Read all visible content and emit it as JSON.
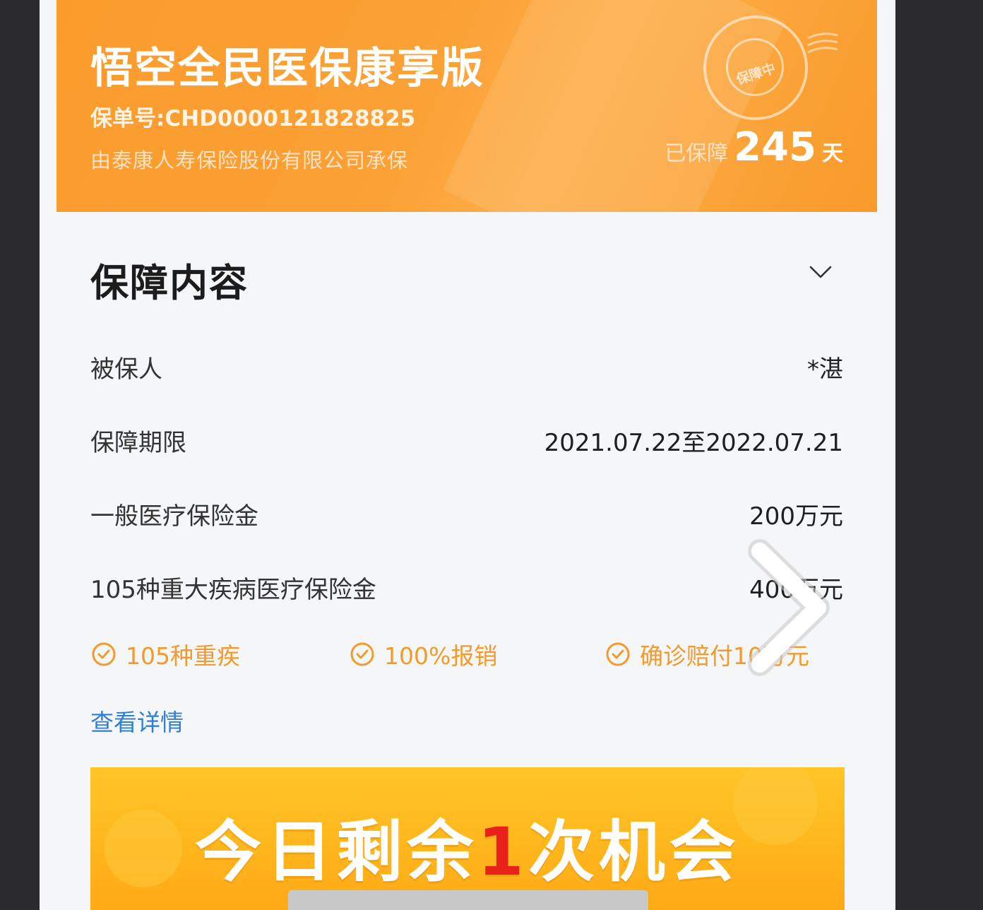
{
  "policy": {
    "title": "悟空全民医保康享版",
    "number_label": "保单号:CHD0000121828825",
    "underwriter": "由泰康人寿保险股份有限公司承保",
    "stamp_text": "保障中",
    "guarded_label": "已保障",
    "guarded_days": "245",
    "guarded_unit": "天"
  },
  "coverage": {
    "section_title": "保障内容",
    "rows": [
      {
        "label": "被保人",
        "value": "*湛"
      },
      {
        "label": "保障期限",
        "value": "2021.07.22至2022.07.21"
      },
      {
        "label": "一般医疗保险金",
        "value": "200万元"
      },
      {
        "label": "105种重大疾病医疗保险金",
        "value": "400万元"
      }
    ],
    "features": [
      {
        "label": "105种重疾"
      },
      {
        "label": "100%报销"
      },
      {
        "label": "确诊赔付10万元"
      }
    ],
    "details_link": "查看详情"
  },
  "banner": {
    "prefix": "今日剩余",
    "count": "1",
    "suffix": "次机会"
  },
  "colors": {
    "card_orange": "#fb9b2c",
    "feature_orange": "#f39a2c",
    "link_blue": "#2f7fd6",
    "banner_yellow": "#ffb51c",
    "count_red": "#e8211d"
  },
  "icons": {
    "collapse": "chevron-down-icon",
    "feature": "check-circle-icon",
    "next": "chevron-right-icon"
  }
}
